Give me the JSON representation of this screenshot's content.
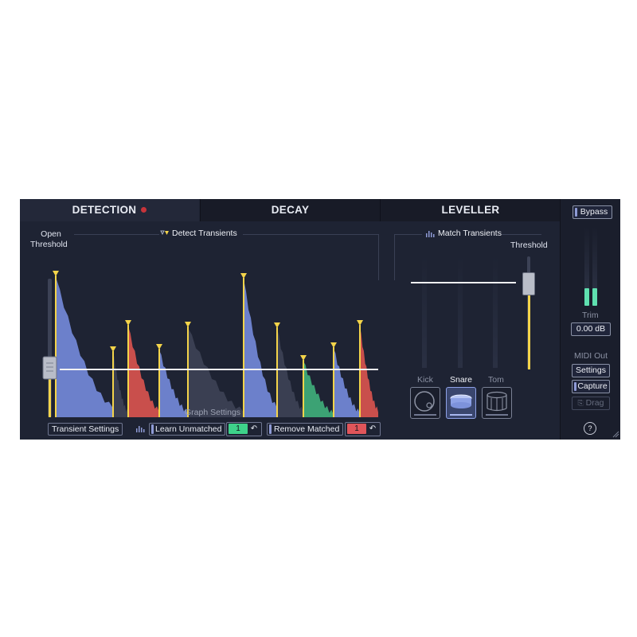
{
  "tabs": {
    "detection": "DETECTION",
    "decay": "DECAY",
    "leveller": "LEVELLER"
  },
  "detection": {
    "open_threshold_line1": "Open",
    "open_threshold_line2": "Threshold",
    "detect_transients": "Detect Transients",
    "graph_settings": "Graph Settings"
  },
  "match": {
    "title": "Match Transients",
    "threshold": "Threshold",
    "instruments": [
      "Kick",
      "Snare",
      "Tom"
    ],
    "selected_instrument": "Snare"
  },
  "bottom_bar": {
    "transient_settings": "Transient Settings",
    "learn_unmatched": "Learn Unmatched",
    "learn_count": "1",
    "remove_matched": "Remove Matched",
    "remove_count": "1"
  },
  "right": {
    "bypass": "Bypass",
    "trim_label": "Trim",
    "trim_value": "0.00 dB",
    "midi_out": "MIDI Out",
    "settings": "Settings",
    "capture": "Capture",
    "drag": "Drag",
    "help": "?"
  },
  "colors": {
    "accent_yellow": "#f4d44a",
    "blue_fill": "#7389d8",
    "red_fill": "#d8544e",
    "green_fill": "#3fae79",
    "gray_fill": "#3d4255",
    "meter_green": "#5fe0b0"
  },
  "icons": [
    "detect-transients-icon",
    "match-transients-icon",
    "learn-icon",
    "undo-icon",
    "drag-icon",
    "help-icon",
    "record-dot-icon"
  ]
}
